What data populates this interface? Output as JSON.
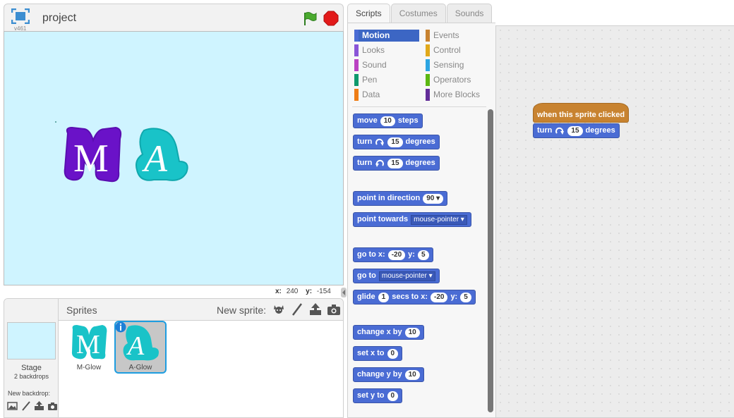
{
  "stage": {
    "version": "v461",
    "project_title": "project",
    "mouse_x_label": "x:",
    "mouse_x": "240",
    "mouse_y_label": "y:",
    "mouse_y": "-154"
  },
  "sprites_pane": {
    "title": "Sprites",
    "new_sprite_label": "New sprite:",
    "stage_label": "Stage",
    "backdrops_count": "2 backdrops",
    "new_backdrop_label": "New backdrop:",
    "sprites": [
      {
        "name": "M-Glow",
        "letter": "M",
        "selected": false
      },
      {
        "name": "A-Glow",
        "letter": "A",
        "selected": true
      }
    ]
  },
  "tabs": [
    "Scripts",
    "Costumes",
    "Sounds"
  ],
  "categories": [
    {
      "label": "Motion",
      "color": "#4a6cd4",
      "selected": true
    },
    {
      "label": "Looks",
      "color": "#8a55d7"
    },
    {
      "label": "Sound",
      "color": "#bb42c3"
    },
    {
      "label": "Pen",
      "color": "#0e9a6c"
    },
    {
      "label": "Data",
      "color": "#ee7d16"
    },
    {
      "label": "Events",
      "color": "#c88330"
    },
    {
      "label": "Control",
      "color": "#e1a91a"
    },
    {
      "label": "Sensing",
      "color": "#2ca5e2"
    },
    {
      "label": "Operators",
      "color": "#5cb712"
    },
    {
      "label": "More Blocks",
      "color": "#632d99"
    }
  ],
  "blocks": {
    "move": {
      "a": "move",
      "n": "10",
      "b": "steps"
    },
    "turn_cw": {
      "a": "turn",
      "n": "15",
      "b": "degrees"
    },
    "turn_ccw": {
      "a": "turn",
      "n": "15",
      "b": "degrees"
    },
    "point_dir": {
      "a": "point in direction",
      "n": "90"
    },
    "point_towards": {
      "a": "point towards",
      "d": "mouse-pointer"
    },
    "goto_xy": {
      "a": "go to x:",
      "x": "-20",
      "b": "y:",
      "y": "5"
    },
    "goto": {
      "a": "go to",
      "d": "mouse-pointer"
    },
    "glide": {
      "a": "glide",
      "n": "1",
      "b": "secs to x:",
      "x": "-20",
      "c": "y:",
      "y": "5"
    },
    "change_x": {
      "a": "change x by",
      "n": "10"
    },
    "set_x": {
      "a": "set x to",
      "n": "0"
    },
    "change_y": {
      "a": "change y by",
      "n": "10"
    },
    "set_y": {
      "a": "set y to",
      "n": "0"
    }
  },
  "script": {
    "hat": "when this sprite clicked",
    "turn": "turn",
    "turn_n": "15",
    "turn_b": "degrees"
  }
}
